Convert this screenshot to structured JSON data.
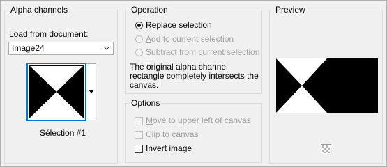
{
  "alpha": {
    "title": "Alpha channels",
    "load_from_doc": {
      "pre": "Load from ",
      "u": "d",
      "post": "ocument:"
    },
    "document_selected": "Image24",
    "selection_name": "Sélection #1"
  },
  "operation": {
    "title": "Operation",
    "replace": {
      "u": "R",
      "rest": "eplace selection"
    },
    "add": {
      "u": "A",
      "rest": "dd to current selection"
    },
    "subtract": {
      "u": "S",
      "rest": "ubtract from current selection"
    },
    "info_line1": "The original alpha channel",
    "info_line2": "rectangle completely intersects the",
    "info_line3": "canvas."
  },
  "options": {
    "title": "Options",
    "move": {
      "u": "M",
      "rest": "ove to upper left of canvas"
    },
    "clip": {
      "u": "C",
      "rest": "lip to canvas"
    },
    "invert": {
      "u": "I",
      "rest": "nvert image"
    }
  },
  "preview": {
    "title": "Preview"
  }
}
